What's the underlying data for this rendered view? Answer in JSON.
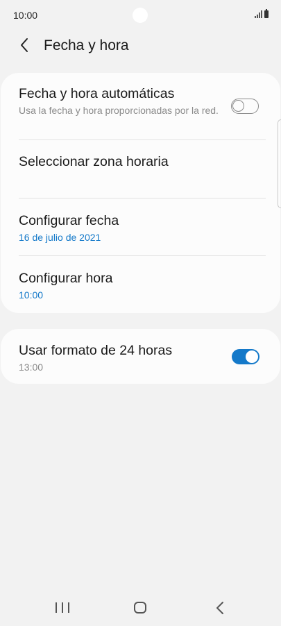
{
  "status_bar": {
    "time": "10:00",
    "icons": [
      "signal-icon",
      "battery-icon"
    ]
  },
  "header": {
    "back_icon": "chevron-left-icon",
    "title": "Fecha y hora"
  },
  "settings": {
    "auto_datetime": {
      "title": "Fecha y hora automáticas",
      "subtitle": "Usa la fecha y hora proporcionadas por la red.",
      "enabled": false
    },
    "timezone": {
      "title": "Seleccionar zona horaria"
    },
    "set_date": {
      "title": "Configurar fecha",
      "value": "16 de julio de 2021"
    },
    "set_time": {
      "title": "Configurar hora",
      "value": "10:00"
    },
    "format_24h": {
      "title": "Usar formato de 24 horas",
      "subtitle": "13:00",
      "enabled": true
    }
  },
  "nav_bar": {
    "icons": [
      "recents-icon",
      "home-icon",
      "back-icon"
    ]
  },
  "colors": {
    "accent": "#1479c9",
    "background": "#f2f2f2",
    "card": "#fcfcfc",
    "secondary_text": "#8a8a8a"
  }
}
